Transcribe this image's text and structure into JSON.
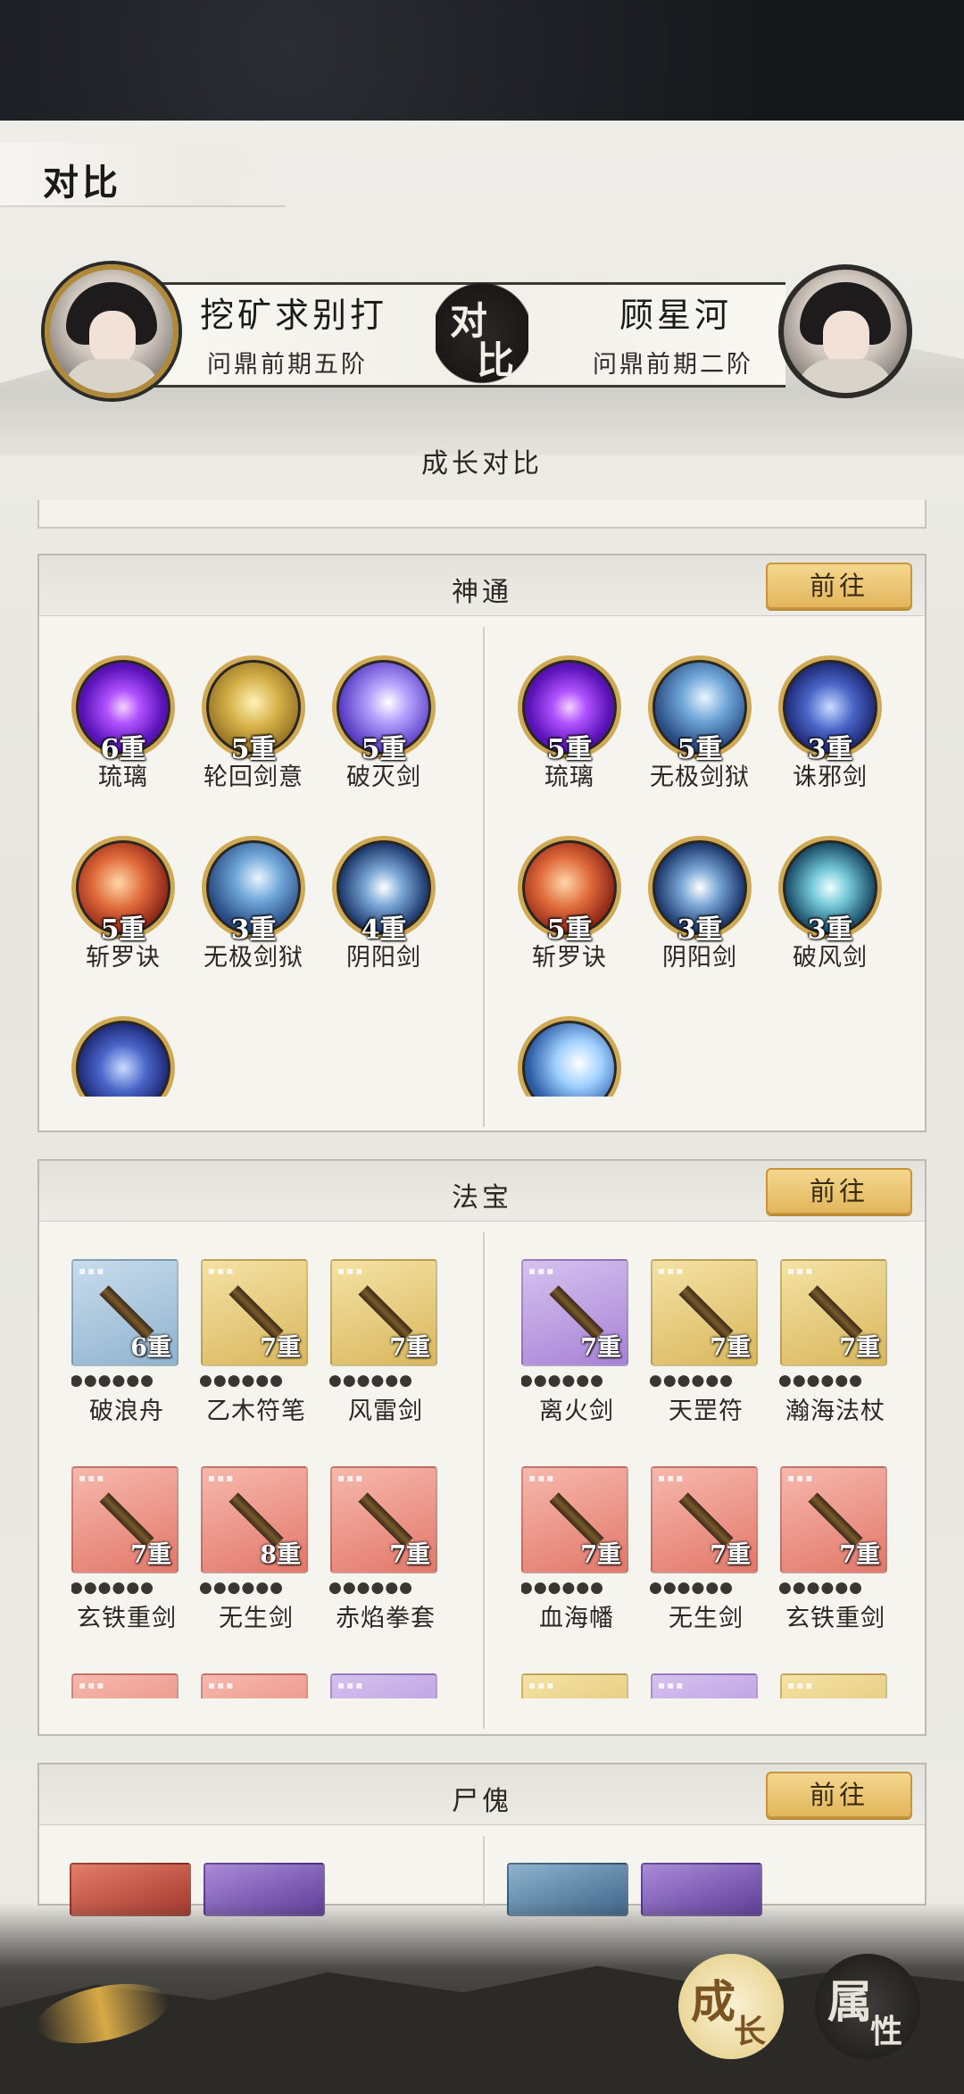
{
  "header": {
    "title": "对比"
  },
  "players": {
    "left": {
      "name": "挖矿求别打",
      "rank": "问鼎前期五阶"
    },
    "right": {
      "name": "顾星河",
      "rank": "问鼎前期二阶"
    },
    "vs_1": "对",
    "vs_2": "比"
  },
  "caption": "成长对比",
  "go_label": "前往",
  "shentong": {
    "title": "神通",
    "left": [
      {
        "level": "6重",
        "name": "琉璃",
        "style": "purple"
      },
      {
        "level": "5重",
        "name": "轮回剑意",
        "style": "gold"
      },
      {
        "level": "5重",
        "name": "破灭剑",
        "style": "violet"
      },
      {
        "level": "5重",
        "name": "斩罗诀",
        "style": "red"
      },
      {
        "level": "3重",
        "name": "无极剑狱",
        "style": "blue"
      },
      {
        "level": "4重",
        "name": "阴阳剑",
        "style": "yin"
      },
      {
        "level": "",
        "name": "",
        "style": "deepblue"
      }
    ],
    "right": [
      {
        "level": "5重",
        "name": "琉璃",
        "style": "purple"
      },
      {
        "level": "5重",
        "name": "无极剑狱",
        "style": "blue"
      },
      {
        "level": "3重",
        "name": "诛邪剑",
        "style": "deepblue"
      },
      {
        "level": "5重",
        "name": "斩罗诀",
        "style": "red"
      },
      {
        "level": "3重",
        "name": "阴阳剑",
        "style": "yin"
      },
      {
        "level": "3重",
        "name": "破风剑",
        "style": "cyan"
      },
      {
        "level": "",
        "name": "",
        "style": "sweep"
      }
    ]
  },
  "fabao": {
    "title": "法宝",
    "left": [
      {
        "level": "6重",
        "name": "破浪舟",
        "style": "blue",
        "stars": "●●●●●●"
      },
      {
        "level": "7重",
        "name": "乙木符笔",
        "style": "gold",
        "stars": "●●●●●●"
      },
      {
        "level": "7重",
        "name": "风雷剑",
        "style": "gold",
        "stars": "●●●●●●"
      },
      {
        "level": "7重",
        "name": "玄铁重剑",
        "style": "red",
        "stars": "●●●●●●"
      },
      {
        "level": "8重",
        "name": "无生剑",
        "style": "red",
        "stars": "●●●●●●"
      },
      {
        "level": "7重",
        "name": "赤焰拳套",
        "style": "red",
        "stars": "●●●●●●"
      },
      {
        "level": "",
        "name": "",
        "style": "red",
        "stars": ""
      },
      {
        "level": "",
        "name": "",
        "style": "red",
        "stars": ""
      },
      {
        "level": "",
        "name": "",
        "style": "purple",
        "stars": ""
      }
    ],
    "right": [
      {
        "level": "7重",
        "name": "离火剑",
        "style": "purple",
        "stars": "●●●●●●"
      },
      {
        "level": "7重",
        "name": "天罡符",
        "style": "gold",
        "stars": "●●●●●●"
      },
      {
        "level": "7重",
        "name": "瀚海法杖",
        "style": "gold",
        "stars": "●●●●●●"
      },
      {
        "level": "7重",
        "name": "血海幡",
        "style": "red",
        "stars": "●●●●●●"
      },
      {
        "level": "7重",
        "name": "无生剑",
        "style": "red",
        "stars": "●●●●●●"
      },
      {
        "level": "7重",
        "name": "玄铁重剑",
        "style": "red",
        "stars": "●●●●●●"
      },
      {
        "level": "",
        "name": "",
        "style": "gold",
        "stars": ""
      },
      {
        "level": "",
        "name": "",
        "style": "purple",
        "stars": ""
      },
      {
        "level": "",
        "name": "",
        "style": "gold",
        "stars": ""
      }
    ]
  },
  "shikui": {
    "title": "尸傀"
  },
  "bottom": {
    "grow": {
      "a": "成",
      "b": "长"
    },
    "attr": {
      "a": "属",
      "b": "性"
    }
  },
  "colors": {
    "accent": "#e2b65c",
    "dark": "#15171b"
  }
}
